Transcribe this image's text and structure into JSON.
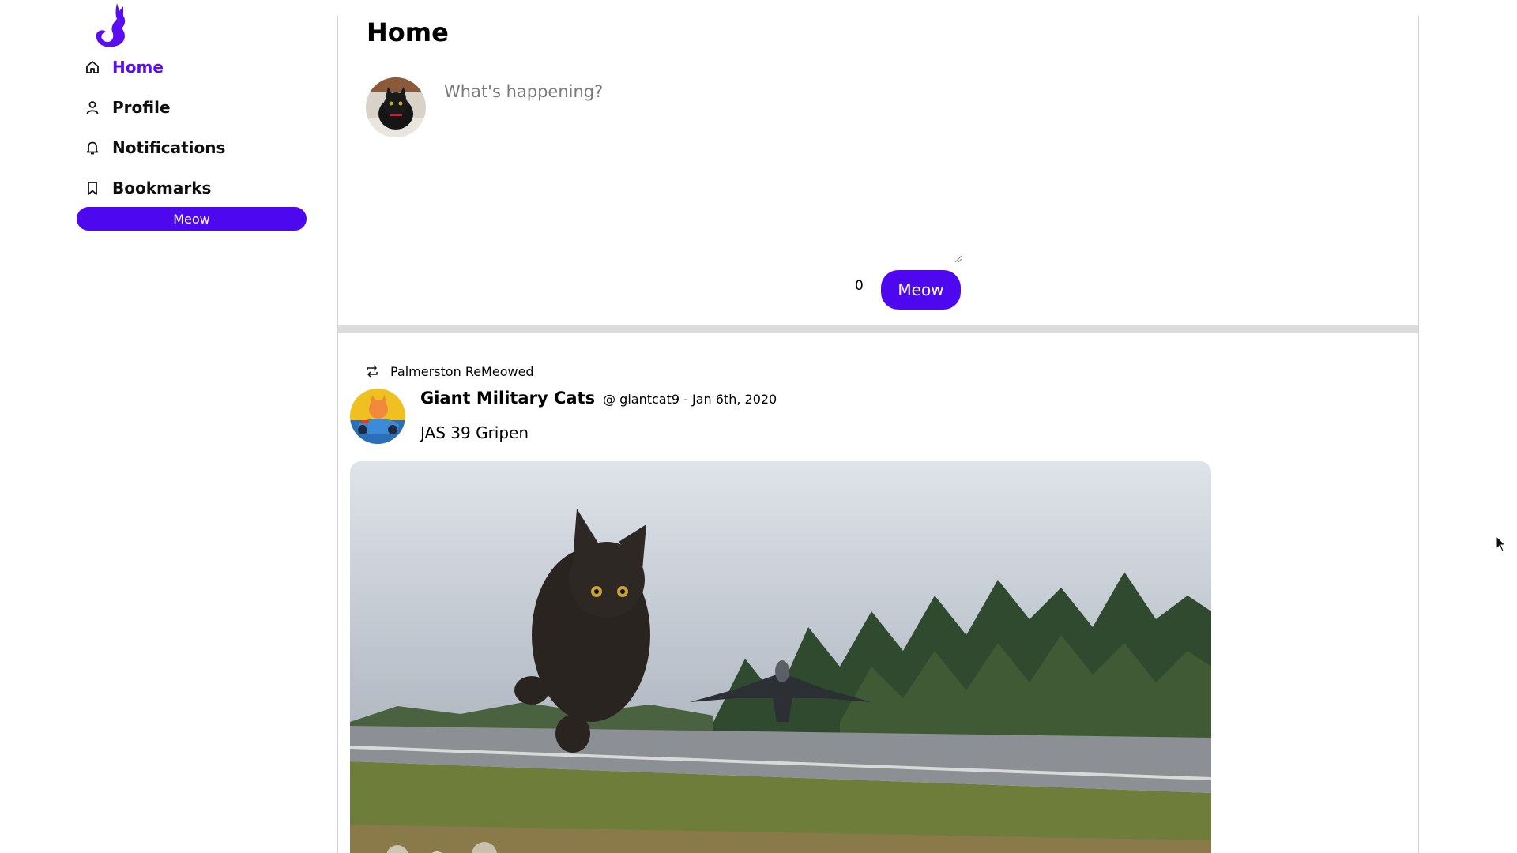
{
  "sidebar": {
    "logo_icon": "cat-logo-icon",
    "items": [
      {
        "label": "Home",
        "icon": "home-icon",
        "active": true
      },
      {
        "label": "Profile",
        "icon": "user-icon",
        "active": false
      },
      {
        "label": "Notifications",
        "icon": "bell-icon",
        "active": false
      },
      {
        "label": "Bookmarks",
        "icon": "bookmark-icon",
        "active": false
      }
    ],
    "meow_button_label": "Meow"
  },
  "main": {
    "title": "Home",
    "composer": {
      "placeholder": "What's happening?",
      "char_count": "0",
      "submit_label": "Meow"
    },
    "feed": [
      {
        "remeow_label": "Palmerston ReMeowed",
        "author_name": "Giant Military Cats",
        "author_meta": "@ giantcat9 - Jan 6th, 2020",
        "text": "JAS 39 Gripen"
      }
    ]
  },
  "colors": {
    "accent": "#4e08f0",
    "active_nav": "#5a0df0",
    "divider": "#dcdcdc"
  }
}
